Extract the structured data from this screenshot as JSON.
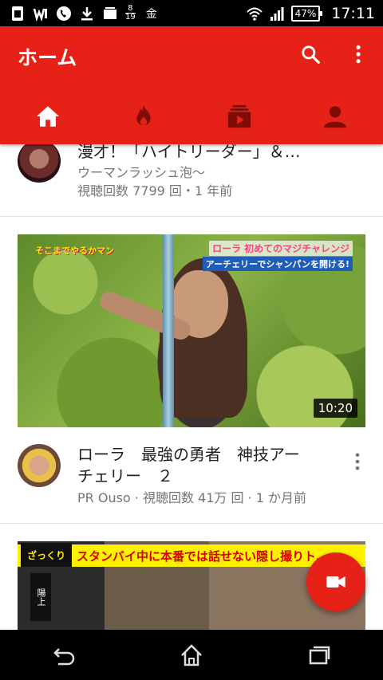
{
  "status_bar": {
    "date_top": "8",
    "date_bottom": "19",
    "weekday": "金",
    "battery": "47%",
    "time": "17:11",
    "icons": [
      "sim-icon",
      "wireless-icon",
      "phone-icon",
      "download-icon",
      "screen-icon",
      "wifi-icon",
      "signal-icon"
    ]
  },
  "app_bar": {
    "title": "ホーム",
    "actions": [
      "search-icon",
      "more-vert-icon"
    ],
    "tabs": [
      {
        "name": "home",
        "icon": "home-icon",
        "active": true
      },
      {
        "name": "trending",
        "icon": "fire-icon",
        "active": false
      },
      {
        "name": "subscriptions",
        "icon": "subscriptions-icon",
        "active": false
      },
      {
        "name": "account",
        "icon": "account-icon",
        "active": false
      }
    ],
    "color": "#e62117"
  },
  "feed": {
    "items": [
      {
        "title": "漫才！「ハイトリーダー」＆…",
        "channel_meta": "ウーマンラッシュ泡〜",
        "views_meta": "視聴回数 7799 回・1 年前"
      },
      {
        "thumb_caption_left": "そこまでやるかマン",
        "thumb_caption_right": "ローラ 初めてのマジチャレンジ",
        "thumb_caption_sub": "アーチェリーでシャンパンを開ける!",
        "duration": "10:20",
        "title_line1": "ローラ　最強の勇者　神技アー",
        "title_line2": "チェリー　２",
        "meta": "PR Ouso · 視聴回数 41万 回 · 1 か月前"
      },
      {
        "thumb_logo": "ざっくり",
        "thumb_banner": "スタンバイ中に本番では話せない隠し撮りト…",
        "thumb_side": "陽上"
      }
    ]
  },
  "fab": {
    "icon": "video-camera-icon"
  },
  "nav_bar": {
    "buttons": [
      "back-icon",
      "home-nav-icon",
      "recents-icon"
    ]
  }
}
